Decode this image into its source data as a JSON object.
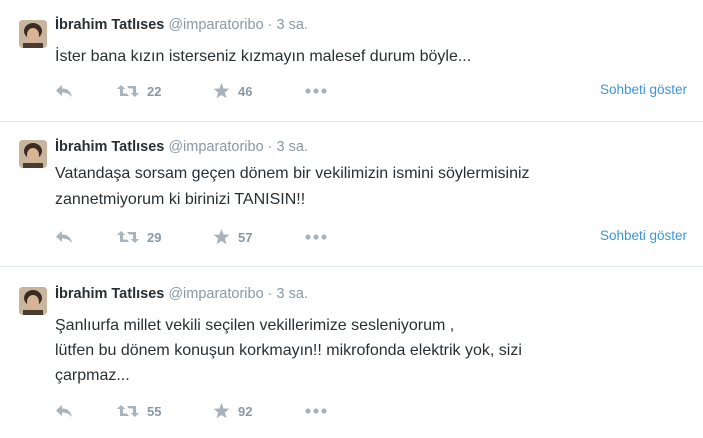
{
  "tweets": [
    {
      "name": "İbrahim Tatlıses",
      "handle": "@imparatoribo",
      "separator": "·",
      "time": "3 sa.",
      "lines": [
        "İster bana kızın isterseniz kızmayın malesef durum böyle..."
      ],
      "retweets": "22",
      "favorites": "46",
      "show_conversation": "Sohbeti göster"
    },
    {
      "name": "İbrahim Tatlıses",
      "handle": "@imparatoribo",
      "separator": "·",
      "time": "3 sa.",
      "lines": [
        "Vatandaşa sorsam geçen dönem bir vekilimizin ismini söylermisiniz",
        "zannetmiyorum ki birinizi TANISIN!!"
      ],
      "retweets": "29",
      "favorites": "57",
      "show_conversation": "Sohbeti göster"
    },
    {
      "name": "İbrahim Tatlıses",
      "handle": "@imparatoribo",
      "separator": "·",
      "time": "3 sa.",
      "lines": [
        "Şanlıurfa millet vekili seçilen vekillerimize sesleniyorum ,",
        "lütfen bu dönem konuşun korkmayın!! mikrofonda elektrik yok, sizi",
        "çarpmaz..."
      ],
      "retweets": "55",
      "favorites": "92",
      "show_conversation": ""
    }
  ],
  "icons": {
    "reply": "reply-icon",
    "retweet": "retweet-icon",
    "favorite": "star-icon",
    "more": "more-icon"
  },
  "colors": {
    "text": "#292f33",
    "muted": "#8899a6",
    "icon": "#a8b4bd",
    "link": "#3b94d9",
    "divider": "#e1e8ed"
  }
}
